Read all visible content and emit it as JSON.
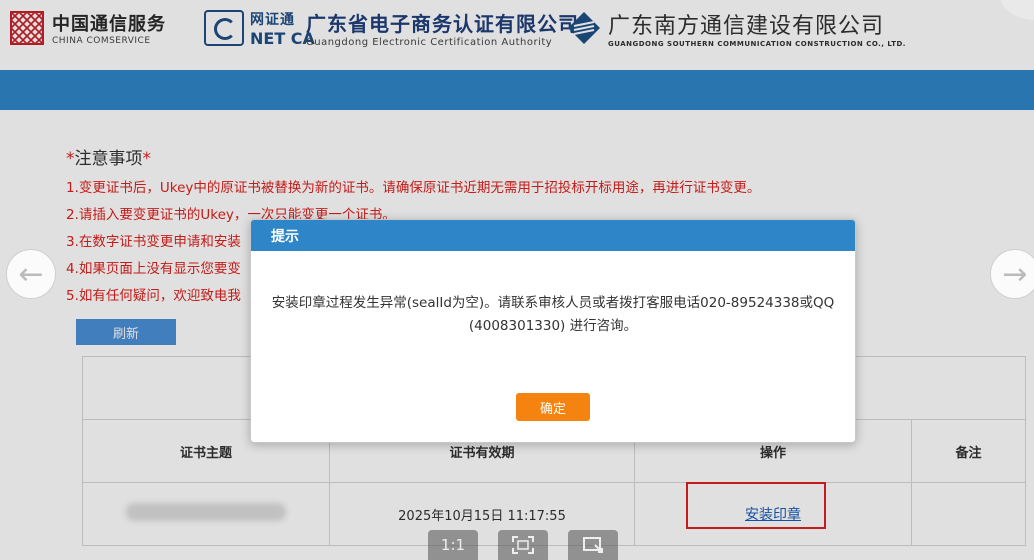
{
  "header": {
    "logo1": {
      "cn": "中国通信服务",
      "en": "CHINA COMSERVICE"
    },
    "logo2": {
      "cn": "网证通",
      "en": "NET CA"
    },
    "logo3": {
      "cn": "广东省电子商务认证有限公司",
      "en": "Guangdong Electronic Certification Authority"
    },
    "logo4": {
      "cn": "广东南方通信建设有限公司",
      "en": "GUANGDONG SOUTHERN COMMUNICATION CONSTRUCTION CO., LTD."
    }
  },
  "notice": {
    "star": "*",
    "title": "注意事项",
    "lines": [
      "1.变更证书后，Ukey中的原证书被替换为新的证书。请确保原证书近期无需用于招投标开标用途，再进行证书变更。",
      "2.请插入要变更证书的Ukey，一次只能变更一个证书。",
      "3.在数字证书变更申请和安装",
      "4.如果页面上没有显示您要变",
      "5.如有任何疑问，欢迎致电我"
    ]
  },
  "refresh_label": "刷新",
  "table": {
    "headers": [
      "证书主题",
      "证书有效期",
      "操作",
      "备注"
    ],
    "row": {
      "validity": "2025年10月15日 11:17:55",
      "action": "安装印章"
    }
  },
  "dialog": {
    "title": "提示",
    "message_line1": "安装印章过程发生异常(sealId为空)。请联系审核人员或者拨打客服电话020-89524338或QQ",
    "message_line2": "(4008301330) 进行咨询。",
    "ok_label": "确定"
  },
  "viewer": {
    "actual_size": "1:1"
  },
  "colors": {
    "brand_blue": "#2e86c8",
    "notice_red": "#e0201c",
    "ok_orange": "#f5830f",
    "link_blue": "#1a5bb8"
  }
}
